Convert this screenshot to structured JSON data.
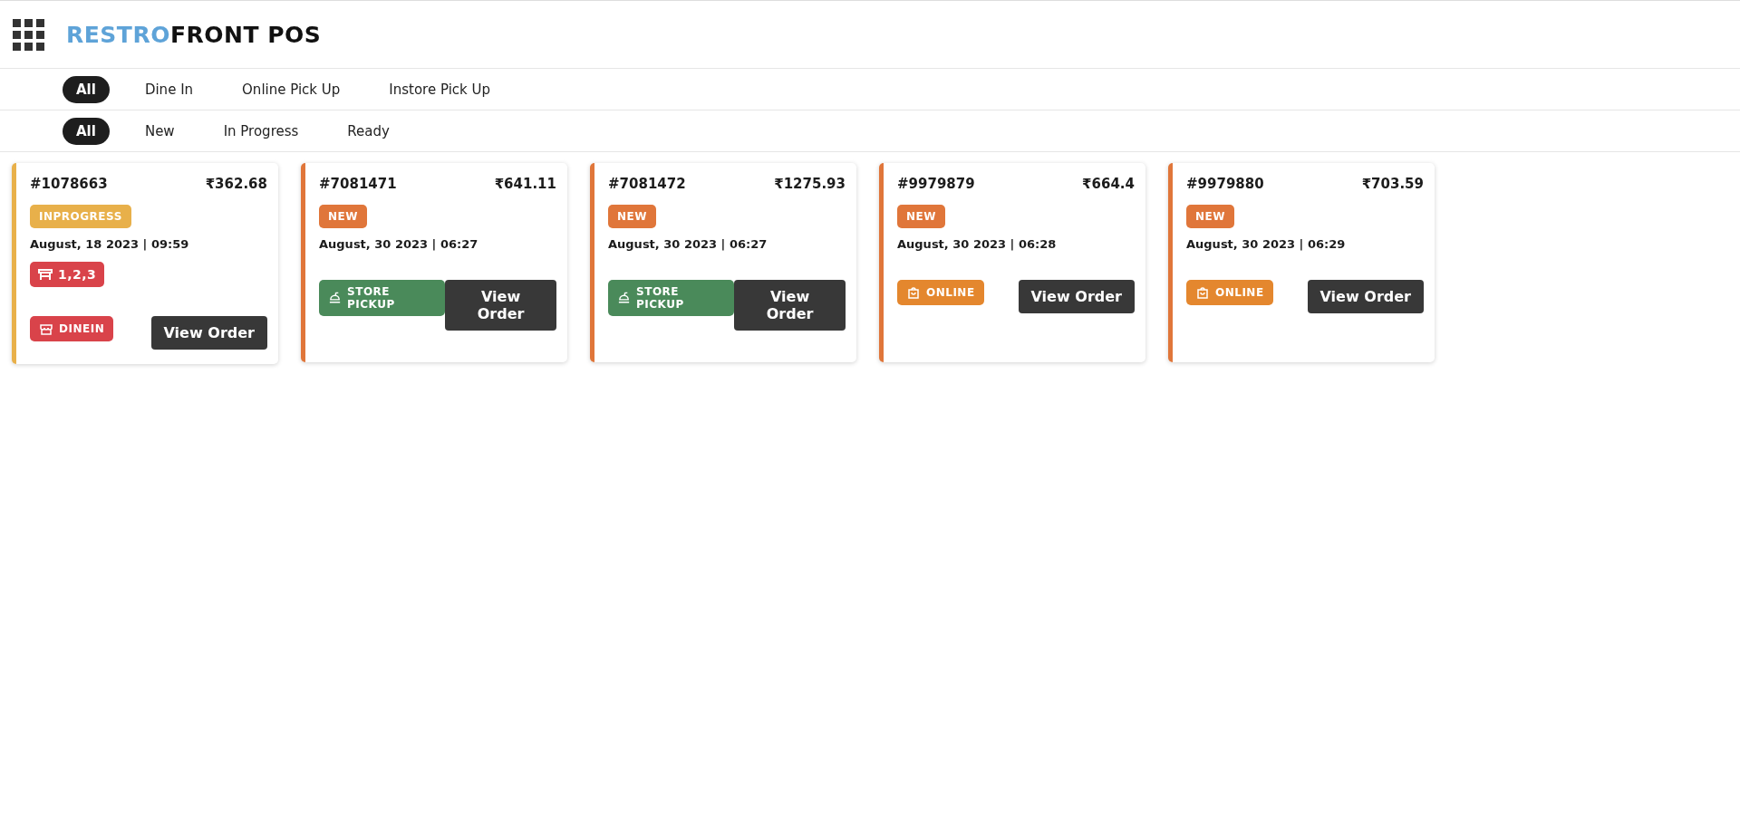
{
  "header": {
    "logo": {
      "accent": "RESTRO",
      "rest": "FRONT POS"
    }
  },
  "order_type_tabs": [
    {
      "label": "All",
      "selected": true
    },
    {
      "label": "Dine In",
      "selected": false
    },
    {
      "label": "Online Pick Up",
      "selected": false
    },
    {
      "label": "Instore Pick Up",
      "selected": false
    }
  ],
  "status_tabs": [
    {
      "label": "All",
      "selected": true
    },
    {
      "label": "New",
      "selected": false
    },
    {
      "label": "In Progress",
      "selected": false
    },
    {
      "label": "Ready",
      "selected": false
    }
  ],
  "orders": [
    {
      "order_id": "#1078663",
      "amount": "₹362.68",
      "status": {
        "kind": "inprogress",
        "label": "INPROGRESS"
      },
      "datetime": "August, 18 2023 | 09:59",
      "tables": "1,2,3",
      "order_type": {
        "kind": "dinein",
        "label": "DINEIN"
      },
      "button": "View Order"
    },
    {
      "order_id": "#7081471",
      "amount": "₹641.11",
      "status": {
        "kind": "new",
        "label": "NEW"
      },
      "datetime": "August, 30 2023 | 06:27",
      "order_type": {
        "kind": "storepickup",
        "label": "STORE PICKUP"
      },
      "button": "View Order"
    },
    {
      "order_id": "#7081472",
      "amount": "₹1275.93",
      "status": {
        "kind": "new",
        "label": "NEW"
      },
      "datetime": "August, 30 2023 | 06:27",
      "order_type": {
        "kind": "storepickup",
        "label": "STORE PICKUP"
      },
      "button": "View Order"
    },
    {
      "order_id": "#9979879",
      "amount": "₹664.4",
      "status": {
        "kind": "new",
        "label": "NEW"
      },
      "datetime": "August, 30 2023 | 06:28",
      "order_type": {
        "kind": "online",
        "label": "ONLINE"
      },
      "button": "View Order"
    },
    {
      "order_id": "#9979880",
      "amount": "₹703.59",
      "status": {
        "kind": "new",
        "label": "NEW"
      },
      "datetime": "August, 30 2023 | 06:29",
      "order_type": {
        "kind": "online",
        "label": "ONLINE"
      },
      "button": "View Order"
    }
  ]
}
